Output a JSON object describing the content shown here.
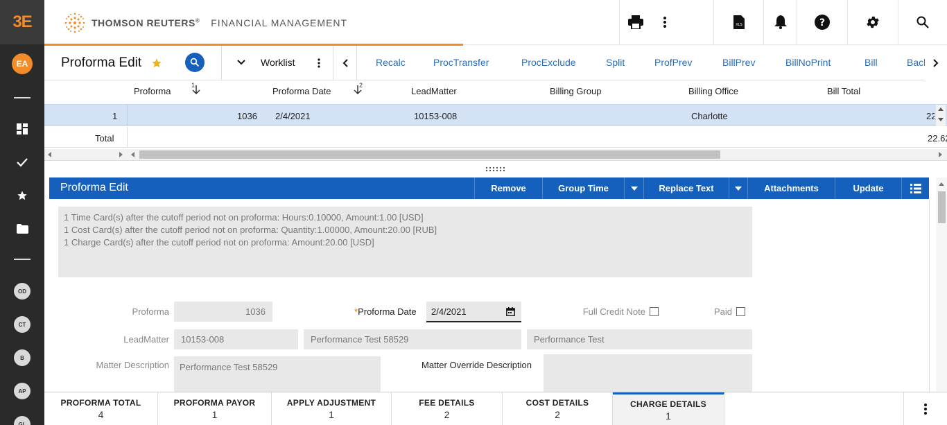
{
  "rail": {
    "logo": "3E",
    "user_initials": "EA",
    "items": [
      "OD",
      "CT",
      "B",
      "AP",
      "GL"
    ]
  },
  "header": {
    "brand": "THOMSON REUTERS",
    "reg": "®",
    "product": "FINANCIAL MANAGEMENT"
  },
  "toolbar": {
    "title": "Proforma Edit",
    "worklist": "Worklist",
    "actions": [
      "Recalc",
      "ProcTransfer",
      "ProcExclude",
      "Split",
      "ProfPrev",
      "BillPrev",
      "BillNoPrint",
      "Bill",
      "Back"
    ]
  },
  "grid": {
    "columns": [
      "Proforma",
      "Proforma Date",
      "LeadMatter",
      "Billing Group",
      "Billing Office",
      "Bill Total"
    ],
    "sort1": "1",
    "sort2": "2",
    "row": {
      "index": "1",
      "proforma": "1036",
      "date": "2/4/2021",
      "lead": "10153-008",
      "group": "",
      "office": "Charlotte",
      "total": "22"
    },
    "total_label": "Total",
    "total_value": "22.62"
  },
  "panel": {
    "title": "Proforma Edit",
    "buttons": [
      "Remove",
      "Group Time",
      "Replace Text",
      "Attachments",
      "Update"
    ],
    "messages": [
      "1 Time Card(s) after the cutoff period not on proforma: Hours:0.10000, Amount:1.00 [USD]",
      "1 Cost Card(s) after the cutoff period not on proforma: Quantity:1.00000, Amount:20.00 [RUB]",
      "1 Charge Card(s) after the cutoff period not on proforma: Amount:20.00 [USD]"
    ],
    "form": {
      "proforma_label": "Proforma",
      "proforma_value": "1036",
      "date_req": "*",
      "date_label": "Proforma Date",
      "date_value": "2/4/2021",
      "full_credit_label": "Full Credit Note",
      "paid_label": "Paid",
      "lead_label": "LeadMatter",
      "lead_value": "10153-008",
      "lead_desc": "Performance Test 58529",
      "lead_client": "Performance Test",
      "matter_desc_label": "Matter Description",
      "matter_desc_value": "Performance Test 58529",
      "override_label": "Matter Override Description"
    }
  },
  "tabs": [
    {
      "label": "PROFORMA TOTAL",
      "count": "4"
    },
    {
      "label": "PROFORMA PAYOR",
      "count": "1"
    },
    {
      "label": "APPLY ADJUSTMENT",
      "count": "1"
    },
    {
      "label": "FEE DETAILS",
      "count": "2"
    },
    {
      "label": "COST DETAILS",
      "count": "2"
    },
    {
      "label": "CHARGE DETAILS",
      "count": "1"
    }
  ],
  "colors": {
    "accent": "#f28c28",
    "primary": "#1560bd",
    "link": "#2a6ebb",
    "rail": "#2a2a2a"
  }
}
